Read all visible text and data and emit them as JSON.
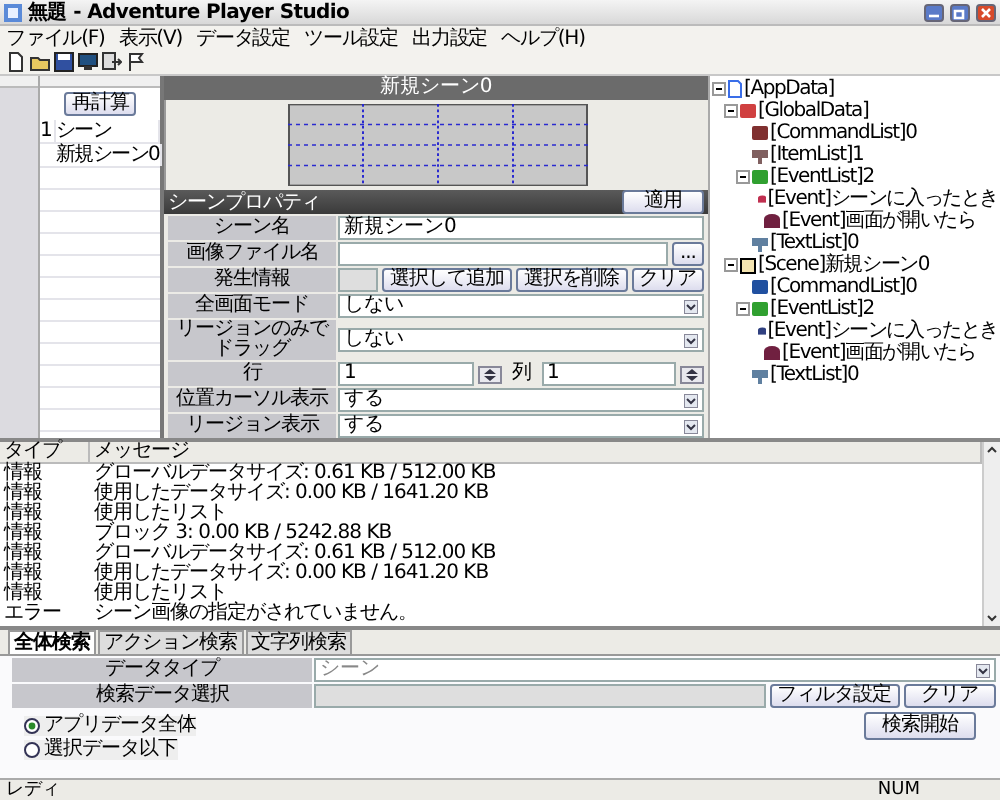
{
  "window": {
    "title": "無題 - Adventure Player Studio"
  },
  "menu": [
    "ファイル(F)",
    "表示(V)",
    "データ設定",
    "ツール設定",
    "出力設定",
    "ヘルプ(H)"
  ],
  "scene_list": {
    "button": "再計算",
    "rows": [
      {
        "number": "1",
        "name": "シーン"
      },
      {
        "name": "新規シーン0"
      }
    ]
  },
  "canvas": {
    "title": "新規シーン0"
  },
  "properties": {
    "title": "シーンプロパティ",
    "apply_button": "適用",
    "rows": [
      {
        "kind": "text",
        "label": "シーン名",
        "value": "新規シーン0"
      },
      {
        "kind": "file",
        "label": "画像ファイル名",
        "button": "..."
      },
      {
        "kind": "buttons",
        "label": "発生情報",
        "buttons": [
          "選択して追加",
          "選択を削除",
          "クリア"
        ]
      },
      {
        "kind": "select",
        "label": "全画面モード",
        "value": "しない"
      },
      {
        "kind": "select",
        "label": "リージョンのみでドラッグ",
        "value": "しない"
      },
      {
        "kind": "spin",
        "label": "行",
        "value": "1",
        "label_2": "列",
        "value_2": "1"
      },
      {
        "kind": "select",
        "label": "位置カーソル表示",
        "value": "する"
      },
      {
        "kind": "select",
        "label": "リージョン表示",
        "value": "する"
      }
    ]
  },
  "tree": [
    {
      "label": "[AppData]",
      "kind": "app",
      "expanded": true,
      "children": [
        {
          "label": "[GlobalData]",
          "kind": "global",
          "expanded": true,
          "children": [
            {
              "label": "[CommandList]0",
              "kind": "command"
            },
            {
              "label": "[ItemList]1",
              "kind": "item"
            },
            {
              "label": "[EventList]2",
              "kind": "eventlist",
              "expanded": true,
              "children": [
                {
                  "label": "[Event]シーンに入ったとき",
                  "kind": "event"
                },
                {
                  "label": "[Event]画面が開いたら",
                  "kind": "event2"
                }
              ]
            },
            {
              "label": "[TextList]0",
              "kind": "text"
            }
          ]
        },
        {
          "label": "[Scene]新規シーン0",
          "kind": "scene",
          "expanded": true,
          "children": [
            {
              "label": "[CommandList]0",
              "kind": "command2"
            },
            {
              "label": "[EventList]2",
              "kind": "eventlist",
              "expanded": true,
              "children": [
                {
                  "label": "[Event]シーンに入ったとき",
                  "kind": "event3"
                },
                {
                  "label": "[Event]画面が開いたら",
                  "kind": "event2"
                }
              ]
            },
            {
              "label": "[TextList]0",
              "kind": "text"
            }
          ]
        }
      ]
    }
  ],
  "log": {
    "columns": [
      "タイプ",
      "メッセージ"
    ],
    "rows": [
      {
        "type": "情報",
        "message": "グローバルデータサイズ: 0.61 KB / 512.00 KB"
      },
      {
        "type": "情報",
        "message": "使用したデータサイズ: 0.00 KB / 1641.20 KB"
      },
      {
        "type": "情報",
        "message": "使用したリスト"
      },
      {
        "type": "情報",
        "message": "ブロック 3: 0.00 KB / 5242.88 KB"
      },
      {
        "type": "情報",
        "message": "グローバルデータサイズ: 0.61 KB / 512.00 KB"
      },
      {
        "type": "情報",
        "message": "使用したデータサイズ: 0.00 KB / 1641.20 KB"
      },
      {
        "type": "情報",
        "message": "使用したリスト"
      },
      {
        "type": "エラー",
        "message": "シーン画像の指定がされていません。"
      }
    ]
  },
  "search": {
    "tabs": [
      {
        "label": "全体検索",
        "selected": true
      },
      {
        "label": "アクション検索",
        "selected": false
      },
      {
        "label": "文字列検索",
        "selected": false
      }
    ],
    "fields": [
      {
        "label": "データタイプ",
        "value": "シーン"
      },
      {
        "label": "検索データ選択"
      }
    ],
    "filter_button": "フィルタ設定",
    "clear_button": "クリア",
    "scopes": [
      {
        "label": "アプリデータ全体",
        "selected": true
      },
      {
        "label": "選択データ以下",
        "selected": false
      }
    ],
    "search_button": "検索開始"
  },
  "status_bar": {
    "text": "レディ",
    "num": "NUM"
  }
}
